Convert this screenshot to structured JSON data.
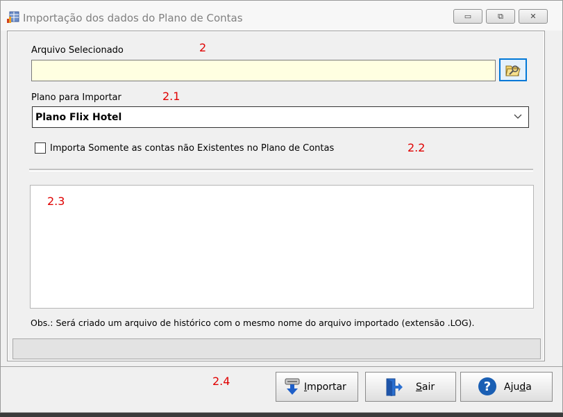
{
  "window": {
    "title": "Importação dos dados do Plano de Contas",
    "controls": {
      "minimize": "▭",
      "maximize": "⧉",
      "close": "✕"
    }
  },
  "form": {
    "file_label": "Arquivo Selecionado",
    "file_value": "",
    "plan_label": "Plano para Importar",
    "plan_selected": "Plano Flix Hotel",
    "checkbox_label": "Importa Somente as contas não Existentes no Plano de Contas",
    "checkbox_checked": false,
    "log_content": "",
    "obs_text": "Obs.: Será criado um arquivo de histórico com o mesmo nome do arquivo importado (extensão .LOG).",
    "status_text": ""
  },
  "annotations": {
    "a1": "2",
    "a2": "2.1",
    "a3": "2.2",
    "a4": "2.3",
    "a5": "2.4"
  },
  "buttons": {
    "importar": {
      "pre": "",
      "accel": "I",
      "post": "mportar"
    },
    "sair": {
      "pre": "",
      "accel": "S",
      "post": "air"
    },
    "ajuda": {
      "pre": "Aju",
      "accel": "d",
      "post": "a"
    }
  },
  "icons": {
    "app": "chart-table-icon",
    "browse": "folder-browse-icon",
    "importar": "import-arrow-icon",
    "sair": "exit-door-icon",
    "ajuda": "help-question-icon"
  },
  "colors": {
    "annotation": "#e00000",
    "file_input_bg": "#ffffe1",
    "focus_border": "#0078d7",
    "help_blue": "#1a5fb4"
  }
}
